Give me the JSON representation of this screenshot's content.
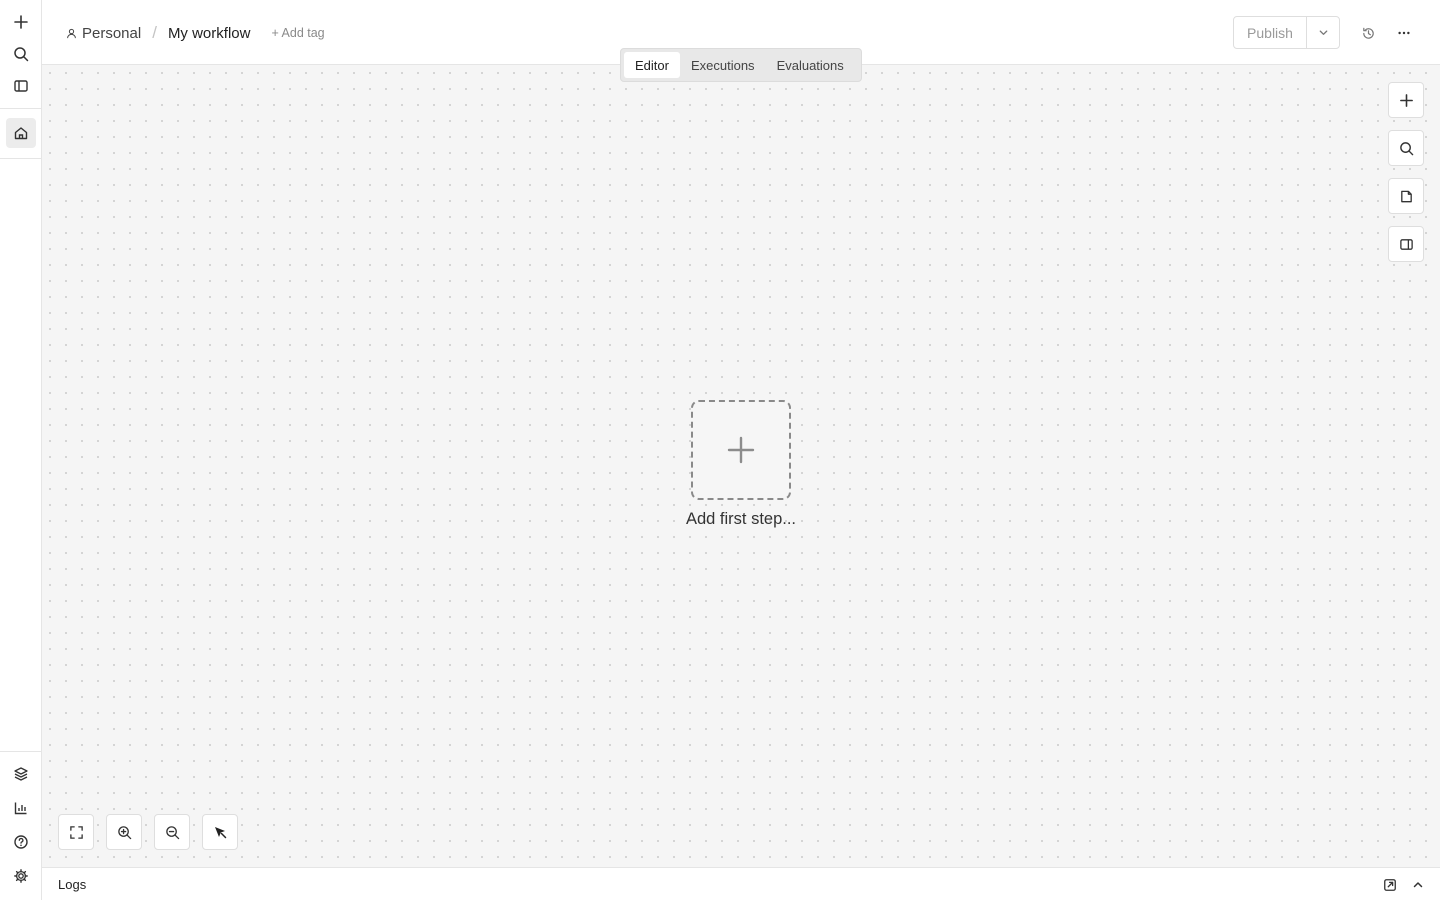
{
  "sidebar": {
    "top_icons": [
      "plus-icon",
      "search-icon",
      "sidebar-toggle-icon"
    ],
    "active_item": "home-icon",
    "bottom_icons": [
      "templates-icon",
      "insights-icon",
      "help-icon",
      "settings-icon"
    ]
  },
  "header": {
    "breadcrumb": {
      "project": "Personal",
      "separator": "/",
      "workflow_name": "My workflow"
    },
    "add_tag_label": "+ Add tag",
    "publish_label": "Publish",
    "tabs": [
      {
        "label": "Editor",
        "active": true
      },
      {
        "label": "Executions",
        "active": false
      },
      {
        "label": "Evaluations",
        "active": false
      }
    ]
  },
  "canvas": {
    "add_first_step_label": "Add first step...",
    "right_tools": [
      "add-node-icon",
      "search-icon",
      "sticky-note-icon",
      "panel-toggle-icon"
    ],
    "zoom_tools": [
      "fit-view-icon",
      "zoom-in-icon",
      "zoom-out-icon",
      "tidy-up-icon"
    ]
  },
  "logs": {
    "label": "Logs"
  },
  "colors": {
    "canvas_bg": "#f5f5f5",
    "border": "#e5e5e5",
    "muted_text": "#9a9a9a"
  }
}
